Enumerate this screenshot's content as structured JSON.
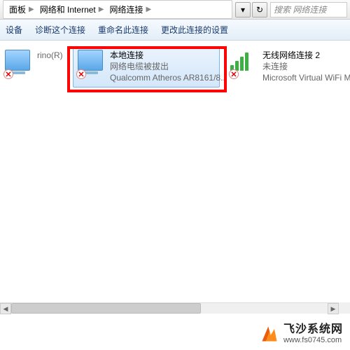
{
  "breadcrumb": {
    "items": [
      "面板",
      "网络和 Internet",
      "网络连接"
    ]
  },
  "search": {
    "placeholder": "搜索 网络连接"
  },
  "toolbar": {
    "items": [
      "设备",
      "诊断这个连接",
      "重命名此连接",
      "更改此连接的设置"
    ]
  },
  "connections": [
    {
      "title": "",
      "status": "",
      "adapter": "rino(R) Wireless-N...",
      "icon": "wired",
      "error": true,
      "selected": false
    },
    {
      "title": "本地连接",
      "status": "网络电缆被拔出",
      "adapter": "Qualcomm Atheros AR8161/8...",
      "icon": "wired",
      "error": true,
      "selected": true
    },
    {
      "title": "无线网络连接 2",
      "status": "未连接",
      "adapter": "Microsoft Virtual WiFi Minip",
      "icon": "wifi",
      "error": true,
      "selected": false
    }
  ],
  "watermark": {
    "title": "飞沙系统网",
    "url": "www.fs0745.com"
  }
}
